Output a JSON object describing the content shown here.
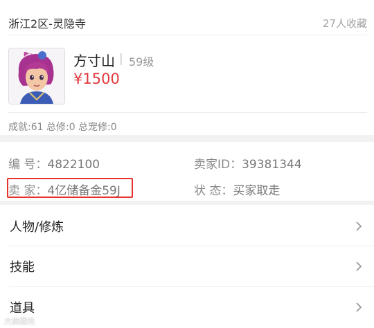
{
  "listing": {
    "server": "浙江2区-灵隐寺",
    "favorites": "27人收藏",
    "char_name": "方寸山",
    "separator": "|",
    "level": "59级",
    "price": "¥1500",
    "achievements": "成就:61 总修:0 总宠修:0"
  },
  "info": {
    "number_label": "编 号：",
    "number_value": "4822100",
    "seller_id_label": "卖家ID：",
    "seller_id_value": "39381344",
    "seller_label": "卖 家：",
    "seller_value": "4亿储备金59J",
    "status_label": "状 态：",
    "status_value": "买家取走"
  },
  "menu": [
    {
      "label": "人物/修炼",
      "icon": "chevron-right-icon"
    },
    {
      "label": "技能",
      "icon": "chevron-right-icon"
    },
    {
      "label": "道具",
      "icon": "chevron-right-icon"
    }
  ],
  "watermark": "大旗图讯",
  "colors": {
    "price": "#e0393e",
    "highlight_box": "#e5322d",
    "background": "#f2f2f2"
  }
}
